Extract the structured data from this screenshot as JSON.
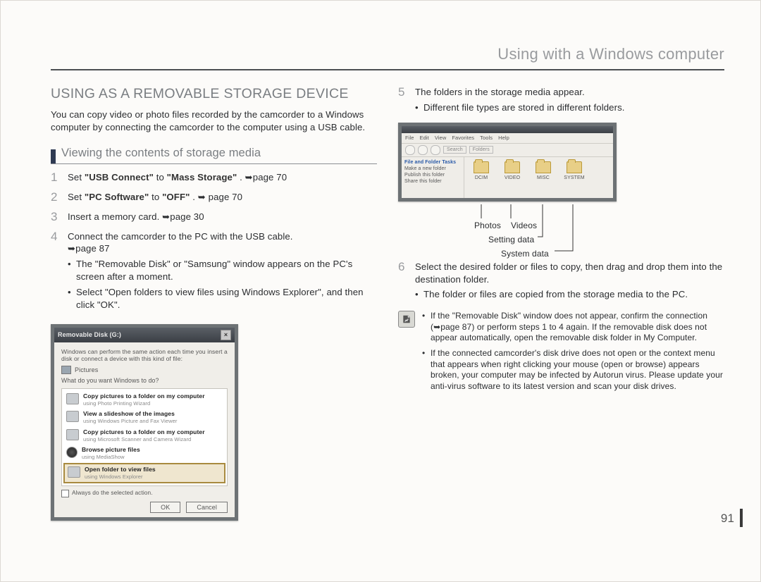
{
  "running_head": "Using with a Windows computer",
  "page_number": "91",
  "left": {
    "h1": "USING AS A REMOVABLE STORAGE DEVICE",
    "intro": "You can copy video or photo files recorded by the camcorder to a Windows computer by connecting the camcorder to the computer using a USB cable.",
    "sub_head": "Viewing the contents of storage media",
    "steps": [
      {
        "num": "1",
        "pre": "Set ",
        "b1": "\"USB Connect\"",
        "mid": " to ",
        "b2": "\"Mass Storage\"",
        "post": ". ",
        "ref": "➥page 70"
      },
      {
        "num": "2",
        "pre": "Set ",
        "b1": "\"PC Software\"",
        "mid": " to ",
        "b2": "\"OFF\"",
        "post": ". ",
        "ref": "➥ page 70"
      },
      {
        "num": "3",
        "text": "Insert a memory card. ",
        "ref": "➥page 30"
      },
      {
        "num": "4",
        "text": "Connect the camcorder to the PC with the USB cable.",
        "ref": "➥page 87",
        "subs": [
          "The \"Removable Disk\" or \"Samsung\" window appears on the PC's screen after a moment.",
          "Select \"Open folders to view files using Windows Explorer\", and then click \"OK\"."
        ]
      }
    ],
    "dialog": {
      "title": "Removable Disk (G:)",
      "lead": "Windows can perform the same action each time you insert a disk or connect a device with this kind of file:",
      "pictures_label": "Pictures",
      "question": "What do you want Windows to do?",
      "options": [
        {
          "title": "Copy pictures to a folder on my computer",
          "sub": "using Photo Printing Wizard"
        },
        {
          "title": "View a slideshow of the images",
          "sub": "using Windows Picture and Fax Viewer"
        },
        {
          "title": "Copy pictures to a folder on my computer",
          "sub": "using Microsoft Scanner and Camera Wizard"
        },
        {
          "title": "Browse picture files",
          "sub": "using MediaShow"
        },
        {
          "title": "Open folder to view files",
          "sub": "using Windows Explorer"
        }
      ],
      "always": "Always do the selected action.",
      "ok": "OK",
      "cancel": "Cancel"
    }
  },
  "right": {
    "steps": [
      {
        "num": "5",
        "text": "The folders in the storage media appear.",
        "subs": [
          "Different file types are stored in different folders."
        ]
      },
      {
        "num": "6",
        "text": "Select the desired folder or files to copy, then drag and drop them into the destination folder.",
        "subs": [
          "The folder or files are copied from the storage media to the PC."
        ]
      }
    ],
    "explorer": {
      "menu": [
        "File",
        "Edit",
        "View",
        "Favorites",
        "Tools",
        "Help"
      ],
      "search": "Search",
      "folders_btn": "Folders",
      "side_title": "File and Folder Tasks",
      "side_items": [
        "Make a new folder",
        "Publish this folder",
        "Share this folder"
      ],
      "folders": [
        "DCIM",
        "VIDEO",
        "MISC",
        "SYSTEM"
      ]
    },
    "callouts": {
      "photos": "Photos",
      "videos": "Videos",
      "setting": "Setting data",
      "system": "System data"
    },
    "note": [
      "If the \"Removable Disk\" window does not appear, confirm the connection (➥page 87) or perform steps 1 to 4 again. If the removable disk does not appear automatically, open the removable disk folder in My Computer.",
      "If the connected camcorder's disk drive does not open or the context menu that appears when right clicking your mouse (open or browse) appears broken, your computer may be infected by Autorun virus. Please update your anti-virus software to its latest version and scan your disk drives."
    ]
  }
}
